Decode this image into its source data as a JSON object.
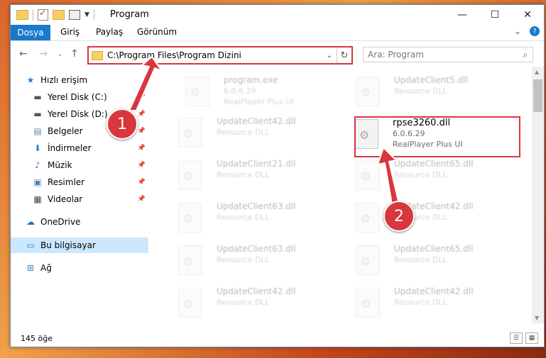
{
  "titlebar": {
    "title": "Program"
  },
  "ribbon": {
    "tabs": [
      "Dosya",
      "Giriş",
      "Paylaş",
      "Görünüm"
    ]
  },
  "address": {
    "path": "C:\\Program Files\\Program Dizini"
  },
  "search": {
    "placeholder": "Ara: Program"
  },
  "sidebar": {
    "items": [
      {
        "label": "Hızlı erişim",
        "icon": "star-icon"
      },
      {
        "label": "Yerel Disk (C:)",
        "icon": "drive-icon"
      },
      {
        "label": "Yerel Disk (D:)",
        "icon": "drive-icon"
      },
      {
        "label": "Belgeler",
        "icon": "documents-icon"
      },
      {
        "label": "İndirmeler",
        "icon": "download-icon"
      },
      {
        "label": "Müzik",
        "icon": "music-icon"
      },
      {
        "label": "Resimler",
        "icon": "pictures-icon"
      },
      {
        "label": "Videolar",
        "icon": "videos-icon"
      },
      {
        "label": "OneDrive",
        "icon": "cloud-icon"
      },
      {
        "label": "Bu bilgisayar",
        "icon": "computer-icon"
      },
      {
        "label": "Ağ",
        "icon": "network-icon"
      }
    ]
  },
  "files": [
    {
      "name": "program.exe",
      "type": "6.0.6.29",
      "desc": "RealPlayer Plus UI"
    },
    {
      "name": "UpdateClient5.dll",
      "type": "Resource DLL",
      "desc": ""
    },
    {
      "name": "UpdateClient42.dll",
      "type": "Resource DLL",
      "desc": ""
    },
    {
      "name": "rpse3260.dll",
      "type": "6.0.6.29",
      "desc": "RealPlayer Plus UI"
    },
    {
      "name": "UpdateClient21.dll",
      "type": "Resource DLL",
      "desc": ""
    },
    {
      "name": "UpdateClient65.dll",
      "type": "Resource DLL",
      "desc": ""
    },
    {
      "name": "UpdateClient63.dll",
      "type": "Resource DLL",
      "desc": ""
    },
    {
      "name": "UpdateClient42.dll",
      "type": "Resource DLL",
      "desc": ""
    },
    {
      "name": "UpdateClient63.dll",
      "type": "Resource DLL",
      "desc": ""
    },
    {
      "name": "UpdateClient65.dll",
      "type": "Resource DLL",
      "desc": ""
    },
    {
      "name": "UpdateClient42.dll",
      "type": "Resource DLL",
      "desc": ""
    },
    {
      "name": "UpdateClient42.dll",
      "type": "Resource DLL",
      "desc": ""
    }
  ],
  "status": {
    "count": "145 öğe"
  },
  "callouts": [
    "1",
    "2"
  ],
  "colors": {
    "accent": "#1979ca",
    "highlight": "#d9363e"
  }
}
